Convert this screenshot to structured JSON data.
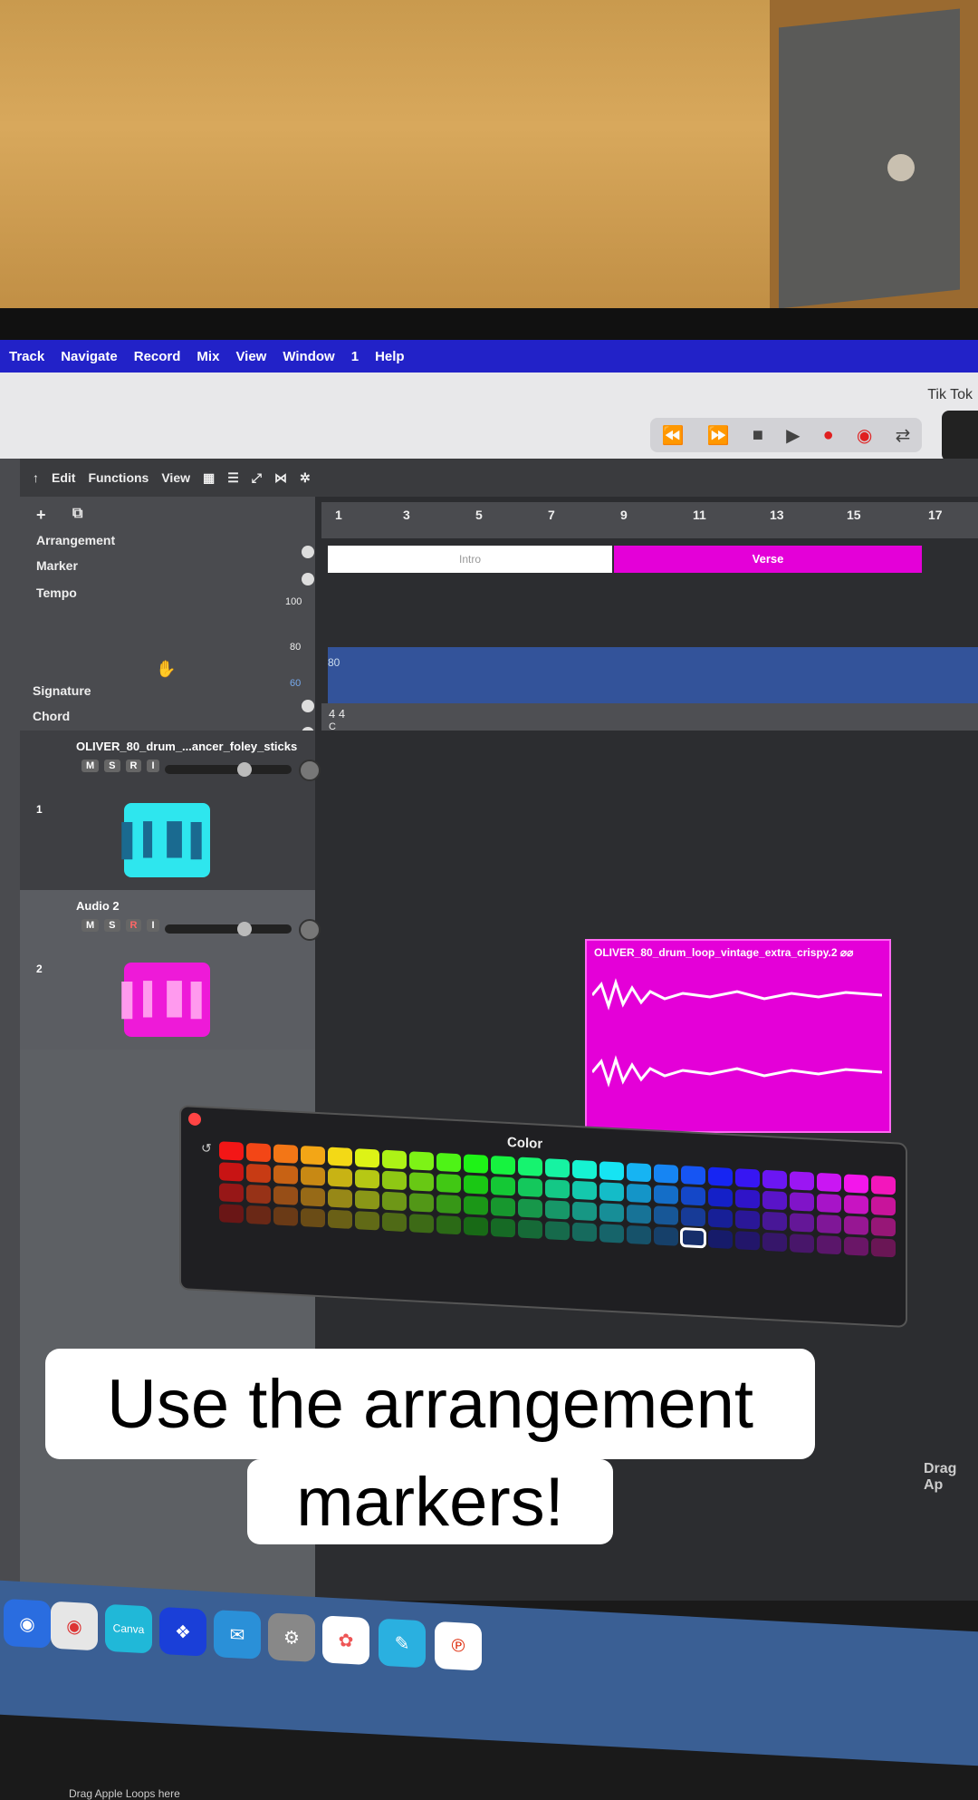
{
  "menubar": [
    "Track",
    "Navigate",
    "Record",
    "Mix",
    "View",
    "Window",
    "1",
    "Help"
  ],
  "toolbar": {
    "window_title": "Tik Tok"
  },
  "transport": {
    "rewind": "⏪",
    "forward": "⏩",
    "stop": "■",
    "play": "▶",
    "record": "●",
    "capture": "◉",
    "cycle": "⇄"
  },
  "editbar": {
    "edit": "Edit",
    "functions": "Functions",
    "view": "View"
  },
  "ruler": [
    "1",
    "3",
    "5",
    "7",
    "9",
    "11",
    "13",
    "15",
    "17"
  ],
  "global_tracks": {
    "arrangement": "Arrangement",
    "marker": "Marker",
    "tempo": "Tempo",
    "tempo_100": "100",
    "tempo_80": "80",
    "tempo_60": "60",
    "signature": "Signature",
    "chord": "Chord"
  },
  "markers": {
    "intro": "Intro",
    "verse": "Verse",
    "tempo_value": "80",
    "signature": "4 4",
    "chord": "C"
  },
  "tracks": [
    {
      "number": "1",
      "name": "OLIVER_80_drum_...ancer_foley_sticks",
      "color": "#2ee6ee"
    },
    {
      "number": "2",
      "name": "Audio 2",
      "color": "#ee1ad8"
    }
  ],
  "region": {
    "name": "OLIVER_80_drum_loop_vintage_extra_crispy.2 ⌀⌀"
  },
  "color_panel": {
    "title": "Color",
    "reset": "↺"
  },
  "droptext": {
    "left": "Drag Apple Loops here",
    "right": "Drag Ap"
  },
  "caption": {
    "line1": "Use the arrangement",
    "line2": "markers!"
  },
  "dock": [
    "Safari",
    "Chrome",
    "Canva",
    "Dropbox",
    "Mail",
    "Settings",
    "Photos",
    "Freeform",
    "Pinterest"
  ]
}
